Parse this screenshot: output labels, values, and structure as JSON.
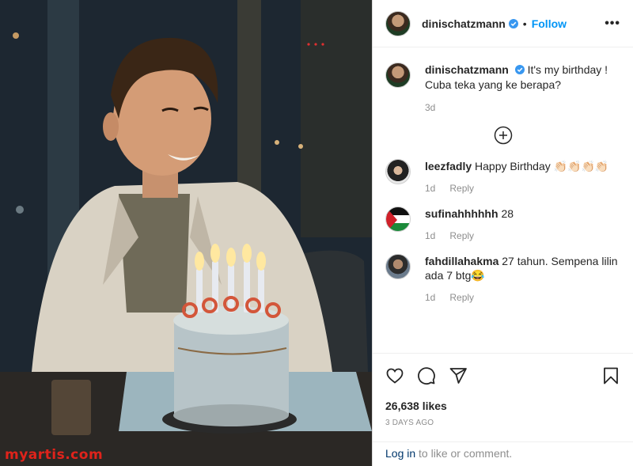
{
  "post": {
    "username": "dinischatzmann",
    "follow_label": "Follow",
    "dot": "•",
    "more_label": "•••",
    "watermark": "myartis.com"
  },
  "caption": {
    "username": "dinischatzmann",
    "text_line1": "It's my birthday !",
    "text_line2": "Cuba teka yang ke berapa?",
    "age": "3d"
  },
  "comments": [
    {
      "username": "leezfadly",
      "text": "Happy Birthday 👏🏻👏🏻👏🏻👏🏻",
      "age": "1d",
      "reply": "Reply"
    },
    {
      "username": "sufinahhhhhh",
      "text": "28",
      "age": "1d",
      "reply": "Reply"
    },
    {
      "username": "fahdillahakma",
      "text": "27 tahun. Sempena lilin ada 7 btg😂",
      "age": "1d",
      "reply": "Reply"
    }
  ],
  "actions": {
    "likes": "26,638 likes",
    "date": "3 DAYS AGO",
    "login_link": "Log in",
    "login_rest": " to like or comment."
  },
  "icons": {
    "like": "heart-icon",
    "comment": "speech-bubble-icon",
    "share": "paper-plane-icon",
    "save": "bookmark-icon",
    "load_more": "plus-circle-icon",
    "verified": "verified-badge-icon"
  },
  "colors": {
    "accent": "#0095f6",
    "verified": "#3897f0",
    "watermark": "#e0231b"
  }
}
